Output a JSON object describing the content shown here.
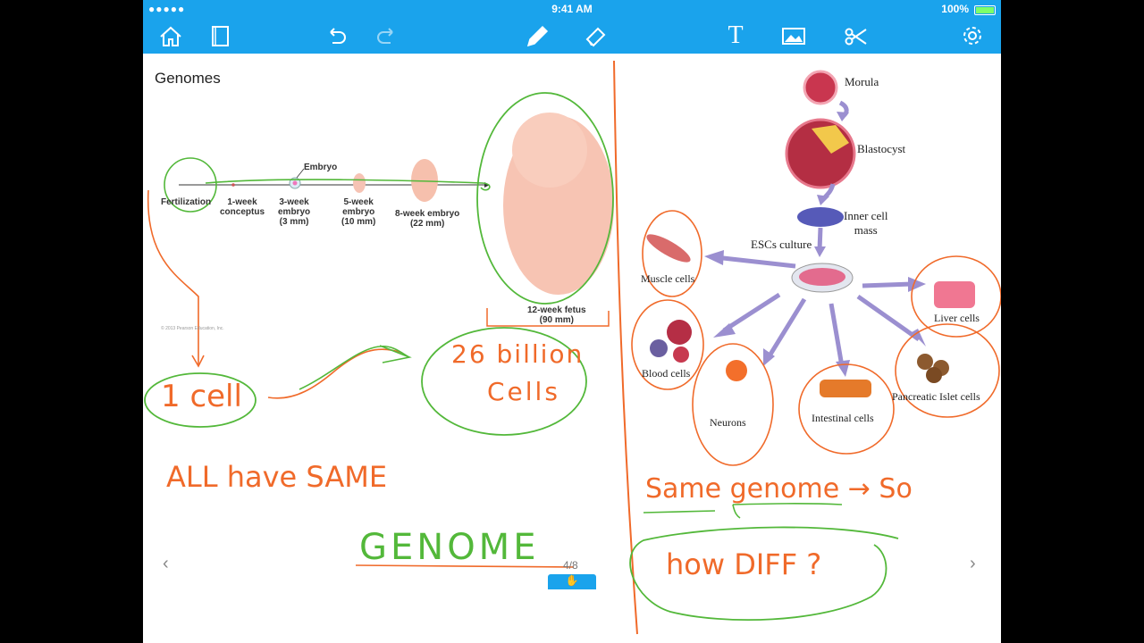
{
  "status": {
    "signal": "●●●●●",
    "time": "9:41 AM",
    "battery": "100%"
  },
  "toolbar": {
    "icons": [
      "home-icon",
      "notebook-icon",
      "undo-icon",
      "redo-icon",
      "pen-icon",
      "eraser-icon",
      "text-icon",
      "image-icon",
      "scissors-icon",
      "settings-icon"
    ],
    "text_tool": "T"
  },
  "page": {
    "title": "Genomes",
    "indicator": "4/8"
  },
  "figure_left": {
    "stages": [
      "Fertilization",
      "1-week\nconceptus",
      "3-week\nembryo\n(3 mm)",
      "5-week\nembryo\n(10 mm)",
      "8-week embryo\n(22 mm)",
      "12-week fetus\n(90 mm)"
    ],
    "embryo_label": "Embryo",
    "copyright": "© 2013 Pearson Education, Inc."
  },
  "figure_right": {
    "labels": {
      "morula": "Morula",
      "blastocyst": "Blastocyst",
      "inner_cell_mass": "Inner cell\nmass",
      "escs_culture": "ESCs culture",
      "muscle": "Muscle cells",
      "liver": "Liver cells",
      "blood": "Blood cells",
      "neurons": "Neurons",
      "intestinal": "Intestinal cells",
      "pancreatic": "Pancreatic Islet cells"
    }
  },
  "handwriting": {
    "one_cell": "1 cell",
    "billion": "26 billion",
    "cells": "Cells",
    "all_have_same": "ALL have  SAME",
    "genome": "GENOME",
    "same_genome": "Same genome → So",
    "how_diff": "how  DIFF ?"
  },
  "colors": {
    "toolbar": "#1aa3ec",
    "ink_orange": "#f06a2a",
    "ink_green": "#53b83a",
    "arrow_purple": "#9b8fd0"
  }
}
